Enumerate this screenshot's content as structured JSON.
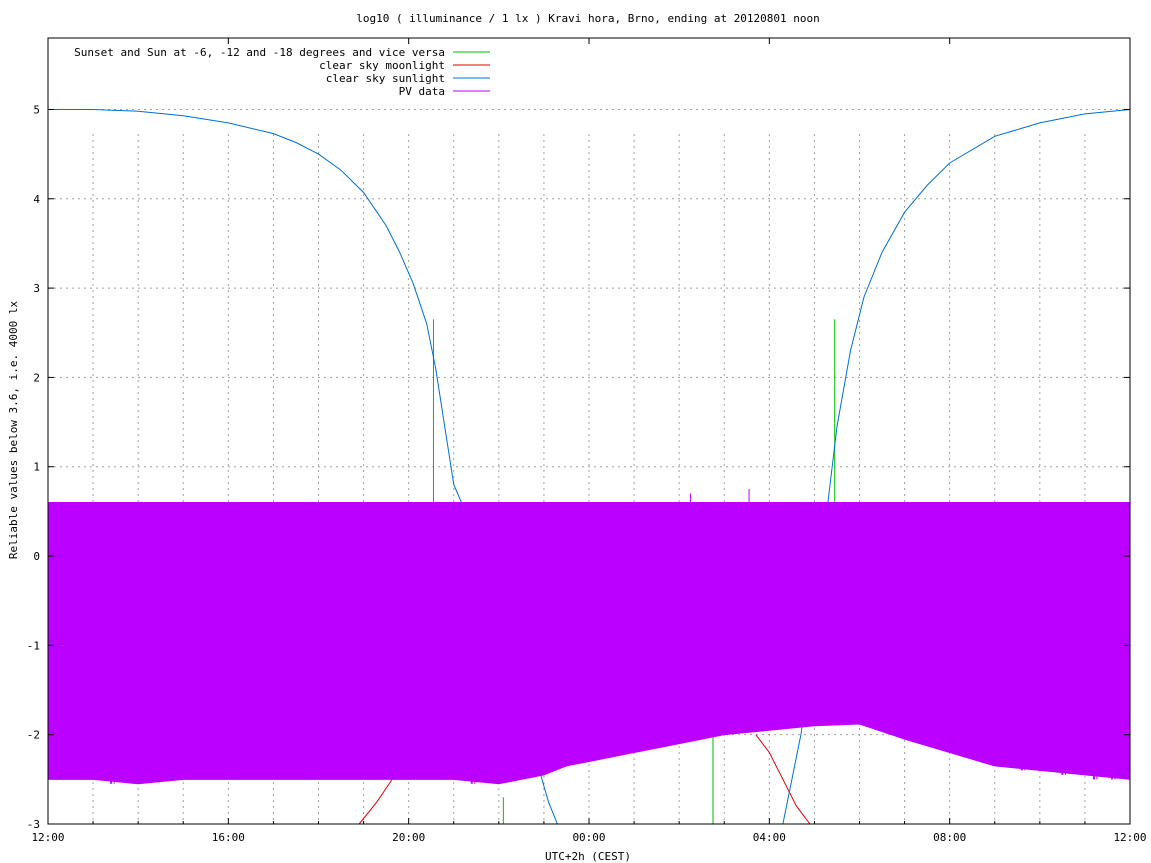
{
  "chart_data": {
    "type": "line",
    "title": "log10 ( illuminance / 1 lx ) Kravi hora, Brno, ending at 20120801 noon",
    "xlabel": "UTC+2h (CEST)",
    "ylabel": "Reliable values below 3.6, i.e. 4000 lx",
    "x_unit": "hours from start (12:00)",
    "xlim": [
      0,
      24
    ],
    "ylim": [
      -3,
      5.8
    ],
    "x_ticks": [
      {
        "x": 0,
        "label": "12:00"
      },
      {
        "x": 4,
        "label": "16:00"
      },
      {
        "x": 8,
        "label": "20:00"
      },
      {
        "x": 12,
        "label": "00:00"
      },
      {
        "x": 16,
        "label": "04:00"
      },
      {
        "x": 20,
        "label": "08:00"
      },
      {
        "x": 24,
        "label": "12:00"
      }
    ],
    "y_ticks": [
      {
        "y": 5,
        "label": "5"
      },
      {
        "y": 4,
        "label": "4"
      },
      {
        "y": 3,
        "label": "3"
      },
      {
        "y": 2,
        "label": "2"
      },
      {
        "y": 1,
        "label": "1"
      },
      {
        "y": 0,
        "label": "0"
      },
      {
        "y": -1,
        "label": "-1"
      },
      {
        "y": -2,
        "label": "-2"
      },
      {
        "y": -3,
        "label": "-3"
      }
    ],
    "grid": true,
    "legend_position": "top-left",
    "series": [
      {
        "name": "Sunset and Sun at -6, -12 and -18 degrees and vice versa",
        "color": "#00c000",
        "kind": "markers",
        "points": [
          {
            "x": 8.55,
            "y0": 0.6,
            "y1": 2.65
          },
          {
            "x": 10.1,
            "y0": -3,
            "y1": -2.7
          },
          {
            "x": 14.75,
            "y0": -3,
            "y1": -2.0
          },
          {
            "x": 17.45,
            "y0": 0.6,
            "y1": 2.65
          }
        ]
      },
      {
        "name": "clear sky moonlight",
        "color": "#e00000",
        "kind": "line",
        "x": [
          6.9,
          7.3,
          7.7,
          8.2,
          8.7,
          9.2,
          9.7,
          10.2
        ],
        "y": [
          -3.0,
          -2.75,
          -2.45,
          -2.15,
          -1.9,
          -1.72,
          -1.62,
          -1.58
        ],
        "x2": [
          15.7,
          16.0,
          16.3,
          16.6,
          16.9
        ],
        "y2": [
          -2.0,
          -2.2,
          -2.5,
          -2.8,
          -3.0
        ]
      },
      {
        "name": "clear sky sunlight",
        "color": "#0070d0",
        "kind": "line",
        "x": [
          0,
          1,
          2,
          3,
          4,
          5,
          5.5,
          6,
          6.5,
          7,
          7.5,
          7.8,
          8.1,
          8.4,
          8.6,
          8.8,
          9.0,
          9.17
        ],
        "y": [
          5.0,
          5.0,
          4.98,
          4.93,
          4.85,
          4.73,
          4.63,
          4.5,
          4.32,
          4.07,
          3.7,
          3.4,
          3.05,
          2.6,
          2.1,
          1.45,
          0.8,
          0.6
        ],
        "x2": [
          10.6,
          10.9,
          11.1,
          11.3,
          16.3,
          16.7,
          17.0,
          17.3,
          17.5,
          17.8,
          18.1,
          18.5,
          19,
          19.5,
          20,
          21,
          22,
          23,
          24
        ],
        "y2": [
          -2.0,
          -2.4,
          -2.75,
          -3.0,
          -3.0,
          -2.0,
          -1.0,
          0.6,
          1.45,
          2.3,
          2.9,
          3.4,
          3.85,
          4.15,
          4.4,
          4.7,
          4.85,
          4.95,
          5.0
        ]
      },
      {
        "name": "PV data",
        "color": "#bb00ff",
        "kind": "band",
        "upper": 0.6,
        "lower_x": [
          0,
          1,
          2,
          3,
          4,
          5,
          6,
          7,
          8,
          9,
          10,
          11,
          11.5,
          12,
          13,
          14,
          15,
          16,
          17,
          18,
          19,
          20,
          21,
          22,
          23,
          24
        ],
        "lower_y": [
          -2.5,
          -2.5,
          -2.55,
          -2.5,
          -2.5,
          -2.5,
          -2.5,
          -2.5,
          -2.5,
          -2.5,
          -2.55,
          -2.45,
          -2.35,
          -2.3,
          -2.2,
          -2.1,
          -2.0,
          -1.95,
          -1.9,
          -1.88,
          -2.05,
          -2.2,
          -2.35,
          -2.4,
          -2.45,
          -2.5
        ],
        "spikes_x": [
          0.9,
          1.4,
          2.3,
          2.8,
          3.5,
          3.9,
          4.2,
          4.5,
          5.2,
          5.6,
          6.1,
          6.4,
          6.8,
          7.1,
          7.5,
          7.9,
          8.3,
          8.8,
          9.4,
          10.6,
          21.0,
          21.6,
          22.5,
          23.2,
          23.6
        ],
        "spikes_y": [
          -1.1,
          -1.05,
          -1.15,
          -0.95,
          -1.0,
          -0.85,
          -0.9,
          -1.1,
          -0.95,
          -0.85,
          -0.8,
          -0.9,
          -0.85,
          -1.0,
          -0.85,
          -0.9,
          -1.15,
          -1.1,
          -1.2,
          -1.5,
          -1.3,
          -1.2,
          -1.45,
          -1.3,
          -1.4
        ],
        "blips_x": [
          14.25,
          15.55
        ],
        "blips_y": [
          0.7,
          0.75
        ]
      }
    ]
  }
}
